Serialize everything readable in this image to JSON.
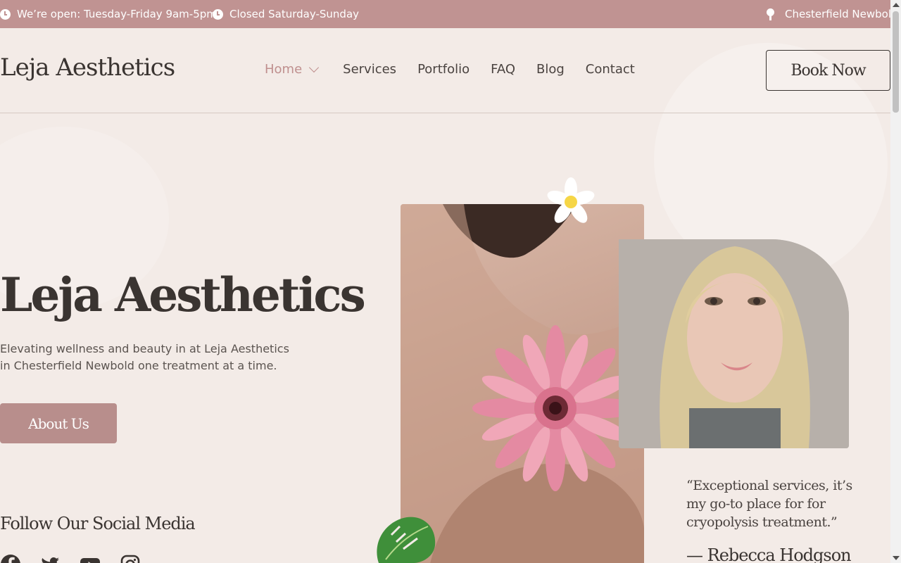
{
  "topbar": {
    "hours_open": "We’re open: Tuesday-Friday 9am-5pm",
    "hours_closed": "Closed Saturday-Sunday",
    "location": "Chesterfield Newbold"
  },
  "header": {
    "brand": "Leja Aesthetics",
    "nav": {
      "home": "Home",
      "services": "Services",
      "portfolio": "Portfolio",
      "faq": "FAQ",
      "blog": "Blog",
      "contact": "Contact"
    },
    "book_label": "Book Now"
  },
  "hero": {
    "title": "Leja Aesthetics",
    "description": "Elevating wellness and beauty in at Leja Aesthetics in Chesterfield Newbold one treatment at a time.",
    "about_label": "About Us",
    "social_title": "Follow Our Social Media",
    "social_icons": [
      "facebook-icon",
      "twitter-icon",
      "youtube-icon",
      "instagram-icon"
    ]
  },
  "testimonial": {
    "quote": "“Exceptional services, it’s my go-to place for for cryopolysis treatment.”",
    "author": "— Rebecca Hodgson"
  },
  "colors": {
    "accent": "#c09392",
    "button": "#b88e8c",
    "background": "#f3ebe7",
    "text": "#3a3431"
  }
}
